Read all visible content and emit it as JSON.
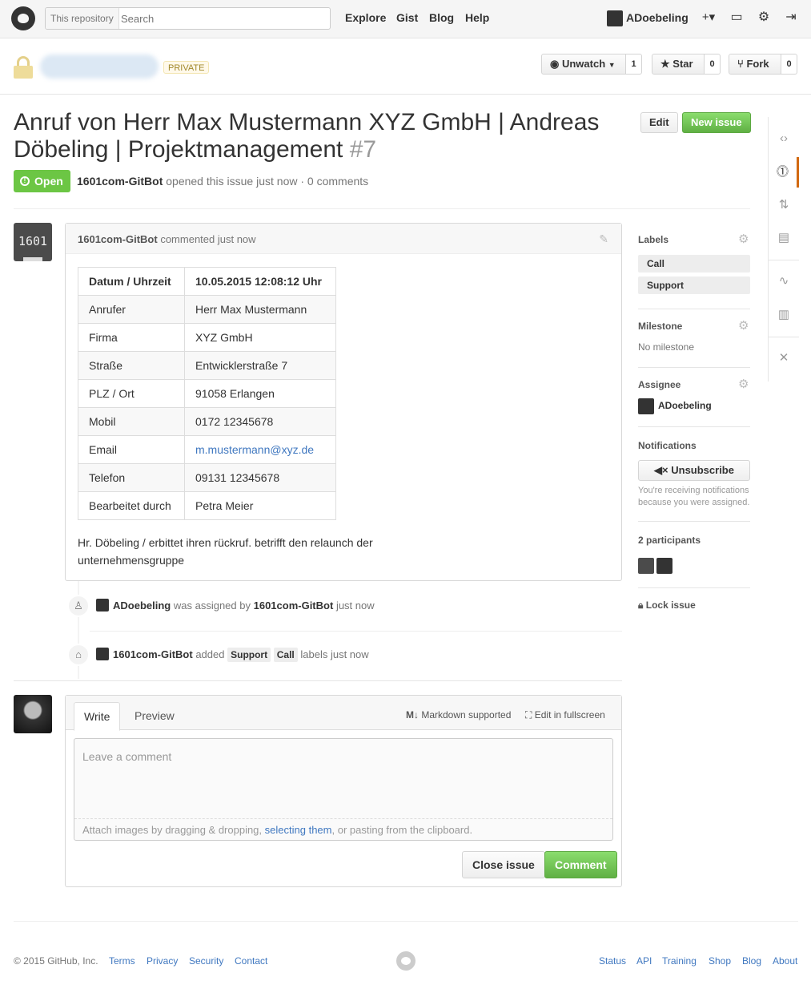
{
  "header": {
    "search_scope": "This repository",
    "search_placeholder": "Search",
    "nav": [
      "Explore",
      "Gist",
      "Blog",
      "Help"
    ],
    "username": "ADoebeling"
  },
  "repo": {
    "private_label": "PRIVATE",
    "unwatch_label": "Unwatch",
    "unwatch_count": "1",
    "star_label": "Star",
    "star_count": "0",
    "fork_label": "Fork",
    "fork_count": "0"
  },
  "issue": {
    "title": "Anruf von Herr Max Mustermann XYZ GmbH | Andreas Döbeling | Projektmanagement",
    "number": "#7",
    "edit_label": "Edit",
    "new_issue_label": "New issue",
    "state": "Open",
    "author": "1601com-GitBot",
    "meta_text": "opened this issue just now · 0 comments"
  },
  "comment": {
    "avatar_text": "1601",
    "author": "1601com-GitBot",
    "meta": "commented just now",
    "table_header": [
      "Datum / Uhrzeit",
      "10.05.2015 12:08:12 Uhr"
    ],
    "table_rows": [
      [
        "Anrufer",
        "Herr Max Mustermann"
      ],
      [
        "Firma",
        "XYZ GmbH"
      ],
      [
        "Straße",
        "Entwicklerstraße 7"
      ],
      [
        "PLZ / Ort",
        "91058 Erlangen"
      ],
      [
        "Mobil",
        "0172 12345678"
      ],
      [
        "Email",
        "m.mustermann@xyz.de"
      ],
      [
        "Telefon",
        "09131 12345678"
      ],
      [
        "Bearbeitet durch",
        "Petra Meier"
      ]
    ],
    "body": "Hr. Döbeling / erbittet ihren rückruf. betrifft den relaunch der unternehmensgruppe"
  },
  "events": {
    "assign": {
      "user": "ADoebeling",
      "text": "was assigned by",
      "by": "1601com-GitBot",
      "time": "just now"
    },
    "labels": {
      "user": "1601com-GitBot",
      "text": "added",
      "label1": "Support",
      "label2": "Call",
      "after": "labels just now"
    }
  },
  "new_comment": {
    "tab_write": "Write",
    "tab_preview": "Preview",
    "markdown": "Markdown supported",
    "fullscreen": "Edit in fullscreen",
    "placeholder": "Leave a comment",
    "attach_before": "Attach images by dragging & dropping,",
    "attach_link": "selecting them",
    "attach_after": ", or pasting from the clipboard.",
    "close_label": "Close issue",
    "comment_label": "Comment"
  },
  "sidebar": {
    "labels_title": "Labels",
    "labels": [
      "Call",
      "Support"
    ],
    "milestone_title": "Milestone",
    "milestone_value": "No milestone",
    "assignee_title": "Assignee",
    "assignee": "ADoebeling",
    "notifications_title": "Notifications",
    "unsubscribe_label": "Unsubscribe",
    "notification_note": "You're receiving notifications because you were assigned.",
    "participants_title": "2 participants",
    "lock_label": "Lock issue"
  },
  "footer": {
    "copyright": "© 2015 GitHub, Inc.",
    "left_links": [
      "Terms",
      "Privacy",
      "Security",
      "Contact"
    ],
    "right_links": [
      "Status",
      "API",
      "Training",
      "Shop",
      "Blog",
      "About"
    ]
  },
  "colors": {
    "accent": "#4078c0",
    "open_green": "#6cc644",
    "rail_active": "#d26911"
  }
}
